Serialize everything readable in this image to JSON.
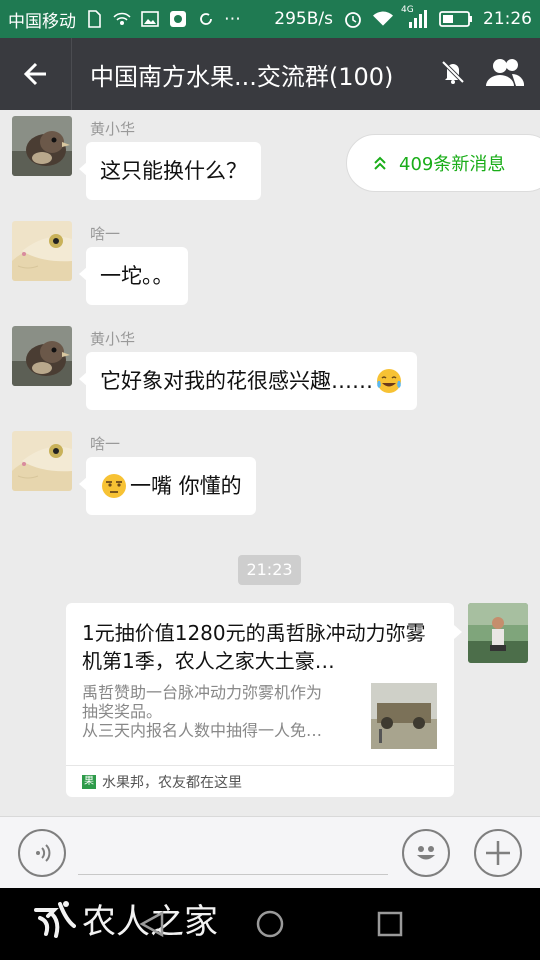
{
  "status_bar": {
    "carrier": "中国移动",
    "speed": "295B/s",
    "network": "4G",
    "time": "21:26"
  },
  "header": {
    "back_icon": "back-arrow-icon",
    "title": "中国南方水果...交流群(100)",
    "mute_icon": "bell-off-icon",
    "members_icon": "group-members-icon"
  },
  "new_messages": {
    "label": "409条新消息",
    "accent": "#1aad19"
  },
  "messages": [
    {
      "sender": "黄小华",
      "text": "这只能换什么？",
      "avatar": "bird-avatar"
    },
    {
      "sender": "啥一",
      "text": "一坨。。",
      "avatar": "gecko-avatar"
    },
    {
      "sender": "黄小华",
      "text": "它好象对我的花很感兴趣……",
      "emoji": "tears-of-joy-emoji",
      "avatar": "bird-avatar"
    },
    {
      "sender": "啥一",
      "text": "一嘴 你懂的",
      "emoji": "smirk-emoji",
      "avatar": "gecko-avatar"
    }
  ],
  "timestamp": "21:23",
  "shared_card": {
    "title": "1元抽价值1280元的禹哲脉冲动力弥雾机第1季，农人之家大土豪…",
    "desc_line1": "禹哲赞助一台脉冲动力弥雾机作为",
    "desc_line2": "抽奖奖品。",
    "desc_line3": "从三天内报名人数中抽得一人免…",
    "source": "水果邦，农友都在这里"
  },
  "input_bar": {
    "voice_icon": "voice-icon",
    "emoji_icon": "emoji-icon",
    "add_icon": "plus-icon"
  },
  "watermark": "农人之家",
  "colors": {
    "status_bar": "#1f7a52",
    "title_bar": "#393a3f",
    "chat_bg": "#ebebeb"
  }
}
